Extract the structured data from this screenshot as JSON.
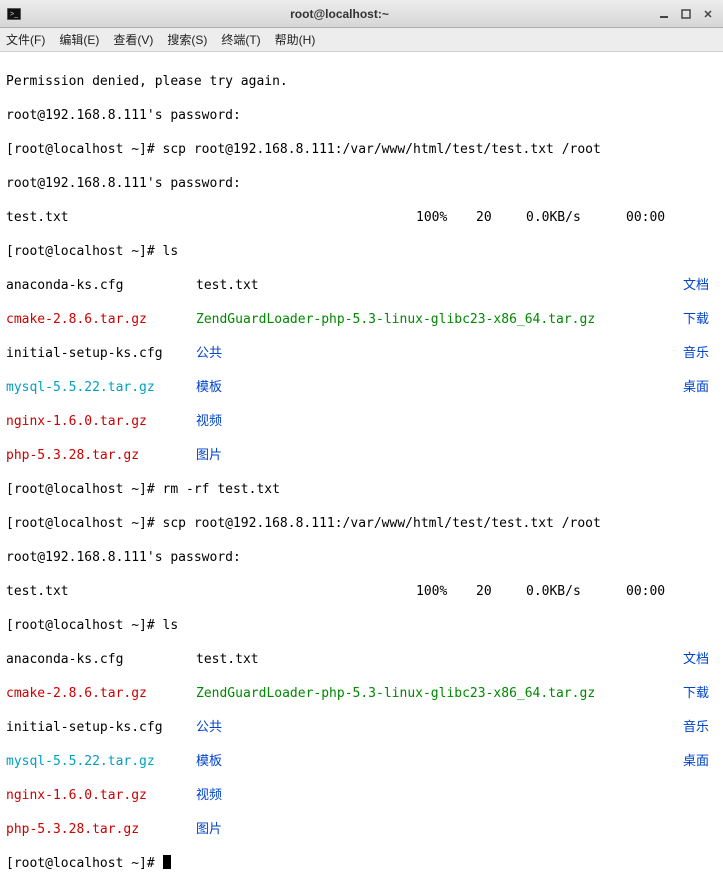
{
  "window": {
    "title": "root@localhost:~"
  },
  "menu": {
    "file": "文件(F)",
    "edit": "编辑(E)",
    "view": "查看(V)",
    "search": "搜索(S)",
    "terminal": "终端(T)",
    "help": "帮助(H)"
  },
  "lines": {
    "l1": "Permission denied, please try again.",
    "l2": "root@192.168.8.111's password:",
    "l3": "[root@localhost ~]# scp root@192.168.8.111:/var/www/html/test/test.txt /root",
    "l4": "root@192.168.8.111's password:",
    "l6": "[root@localhost ~]# ls",
    "l13": "[root@localhost ~]# rm -rf test.txt",
    "l14": "[root@localhost ~]# scp root@192.168.8.111:/var/www/html/test/test.txt /root",
    "l15": "root@192.168.8.111's password:",
    "l17": "[root@localhost ~]# ls",
    "l24": "[root@localhost ~]# "
  },
  "progress": {
    "fname": "test.txt",
    "pct": "100%",
    "bytes": "20",
    "speed": "0.0KB/s",
    "time": "00:00"
  },
  "ls1": {
    "r1c1": "anaconda-ks.cfg",
    "r1c2": "test.txt",
    "r1c3": "文档",
    "r2c1": "cmake-2.8.6.tar.gz",
    "r2c2": "ZendGuardLoader-php-5.3-linux-glibc23-x86_64.tar.gz",
    "r2c3": "下载",
    "r3c1": "initial-setup-ks.cfg",
    "r3c2": "公共",
    "r3c3": "音乐",
    "r4c1": "mysql-5.5.22.tar.gz",
    "r4c2": "模板",
    "r4c3": "桌面",
    "r5c1": "nginx-1.6.0.tar.gz",
    "r5c2": "视频",
    "r6c1": "php-5.3.28.tar.gz",
    "r6c2": "图片"
  }
}
